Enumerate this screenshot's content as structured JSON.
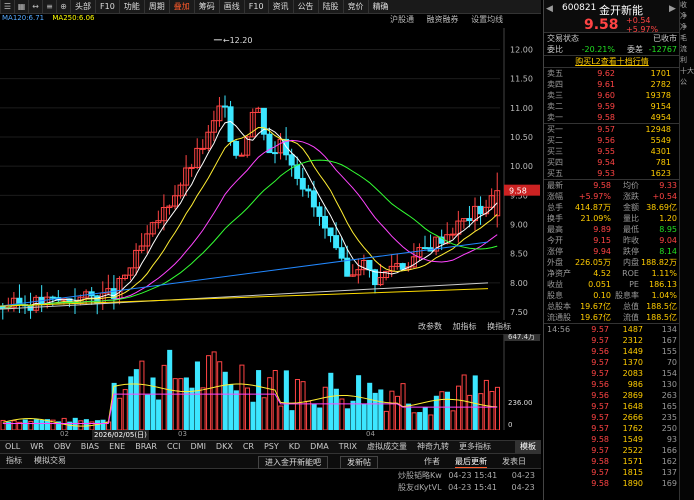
{
  "toolbar": {
    "items": [
      "头部",
      "F10",
      "功能",
      "周期",
      "叠加",
      "筹码",
      "画线",
      "F10",
      "资讯",
      "公告",
      "陆股",
      "竞价",
      "精确"
    ],
    "icons": [
      "menu-icon",
      "grid-icon",
      "arrow-icon",
      "list-icon",
      "zoom-icon"
    ],
    "active_index": 4
  },
  "ma_legend": {
    "ma120": "MA120:6.71",
    "ma250": "MA250:6.06"
  },
  "subtoolbar": [
    "沪股通",
    "融资融券",
    "设置均线"
  ],
  "price_axis": [
    "12.00",
    "11.50",
    "11.00",
    "10.50",
    "10.00",
    "9.50",
    "9.00",
    "8.50",
    "8.00",
    "7.50"
  ],
  "high_marker": "12.20",
  "vol_axis": [
    "647.4万",
    "236.00",
    "0"
  ],
  "vol_tools": [
    "改参数",
    "加指标",
    "换指标"
  ],
  "dates": [
    "02",
    "2026/02/05(日)",
    "03",
    "04"
  ],
  "indicator_bar": [
    "OLL",
    "WR",
    "OBV",
    "BIAS",
    "ENE",
    "BRAR",
    "CCI",
    "DMI",
    "DKX",
    "CR",
    "PSY",
    "KD",
    "DMA",
    "TRIX",
    "虚拟成交量",
    "神奇九转",
    "更多指标"
  ],
  "indicator_right": "模板",
  "bottom_tabs": [
    "指标",
    "模拟交易"
  ],
  "news": {
    "trade_left": "进入金开新能吧",
    "trade_mid": "发新帖",
    "tabs": [
      "作者",
      "最后更新"
    ],
    "more": "发表日",
    "rows": [
      {
        "title": "炒股韬略Kw",
        "date": "04-23 15:41",
        "date2": "04-23"
      },
      {
        "title": "股友dKytVL",
        "date": "04-23 15:41",
        "date2": "04-23"
      },
      {
        "title": "梦想...",
        "date": "04-23 15:41",
        "date2": "04-23"
      }
    ]
  },
  "quote": {
    "code": "600821",
    "name": "金开新能",
    "price": "9.58",
    "change": "+0.54",
    "pct": "+5.97%",
    "status_label": "交易状态",
    "status_value": "已收市",
    "ratio_label": "委比",
    "ratio_value": "-20.21%",
    "diff_label": "委差",
    "diff_value": "-12767",
    "l2_banner": "购买L2查看十档行情",
    "asks": [
      {
        "label": "卖五",
        "price": "9.62",
        "vol": "1701"
      },
      {
        "label": "卖四",
        "price": "9.61",
        "vol": "2782"
      },
      {
        "label": "卖三",
        "price": "9.60",
        "vol": "19378"
      },
      {
        "label": "卖二",
        "price": "9.59",
        "vol": "9154"
      },
      {
        "label": "卖一",
        "price": "9.58",
        "vol": "4954"
      }
    ],
    "bids": [
      {
        "label": "买一",
        "price": "9.57",
        "vol": "12948"
      },
      {
        "label": "买二",
        "price": "9.56",
        "vol": "5549"
      },
      {
        "label": "买三",
        "price": "9.55",
        "vol": "4301"
      },
      {
        "label": "买四",
        "price": "9.54",
        "vol": "781"
      },
      {
        "label": "买五",
        "price": "9.53",
        "vol": "1623"
      }
    ],
    "stats": [
      [
        "最新",
        "9.58",
        "均价",
        "9.33"
      ],
      [
        "涨幅",
        "+5.97%",
        "涨跌",
        "+0.54"
      ],
      [
        "总手",
        "414.87万",
        "金额",
        "38.69亿"
      ],
      [
        "换手",
        "21.09%",
        "量比",
        "1.20"
      ],
      [
        "最高",
        "9.89",
        "最低",
        "8.95"
      ],
      [
        "今开",
        "9.15",
        "昨收",
        "9.04"
      ],
      [
        "涨停",
        "9.94",
        "跌停",
        "8.14"
      ],
      [
        "外盘",
        "226.05万",
        "内盘",
        "188.82万"
      ],
      [
        "净资产",
        "4.52",
        "ROE",
        "1.11%"
      ],
      [
        "收益",
        "0.051",
        "PE",
        "186.13"
      ],
      [
        "股息",
        "0.10",
        "股息率",
        "1.04%"
      ],
      [
        "总股本",
        "19.67亿",
        "总值",
        "188.5亿"
      ],
      [
        "流通股",
        "19.67亿",
        "流值",
        "188.5亿"
      ]
    ],
    "ticks": [
      {
        "t": "14:56",
        "p": "9.57",
        "v": "1487",
        "n": "134"
      },
      {
        "t": "",
        "p": "9.57",
        "v": "2312",
        "n": "167"
      },
      {
        "t": "",
        "p": "9.56",
        "v": "1449",
        "n": "155"
      },
      {
        "t": "",
        "p": "9.57",
        "v": "1370",
        "n": "70"
      },
      {
        "t": "",
        "p": "9.57",
        "v": "2083",
        "n": "154"
      },
      {
        "t": "",
        "p": "9.56",
        "v": "986",
        "n": "130"
      },
      {
        "t": "",
        "p": "9.56",
        "v": "2869",
        "n": "263"
      },
      {
        "t": "",
        "p": "9.57",
        "v": "1648",
        "n": "165"
      },
      {
        "t": "",
        "p": "9.57",
        "v": "2666",
        "n": "235"
      },
      {
        "t": "",
        "p": "9.57",
        "v": "1762",
        "n": "250"
      },
      {
        "t": "",
        "p": "9.58",
        "v": "1549",
        "n": "93"
      },
      {
        "t": "",
        "p": "9.57",
        "v": "2522",
        "n": "166"
      },
      {
        "t": "",
        "p": "9.58",
        "v": "1571",
        "n": "162"
      },
      {
        "t": "",
        "p": "9.57",
        "v": "1815",
        "n": "137"
      },
      {
        "t": "",
        "p": "9.58",
        "v": "1890",
        "n": "169"
      }
    ]
  },
  "edge_labels": [
    "收",
    "净",
    "净",
    "毛",
    "流",
    "利",
    "十大",
    "公",
    ""
  ],
  "colors": {
    "up": "#ff4444",
    "down": "#22e6ff",
    "bg": "#000000",
    "accent": "#ff5a2a"
  }
}
